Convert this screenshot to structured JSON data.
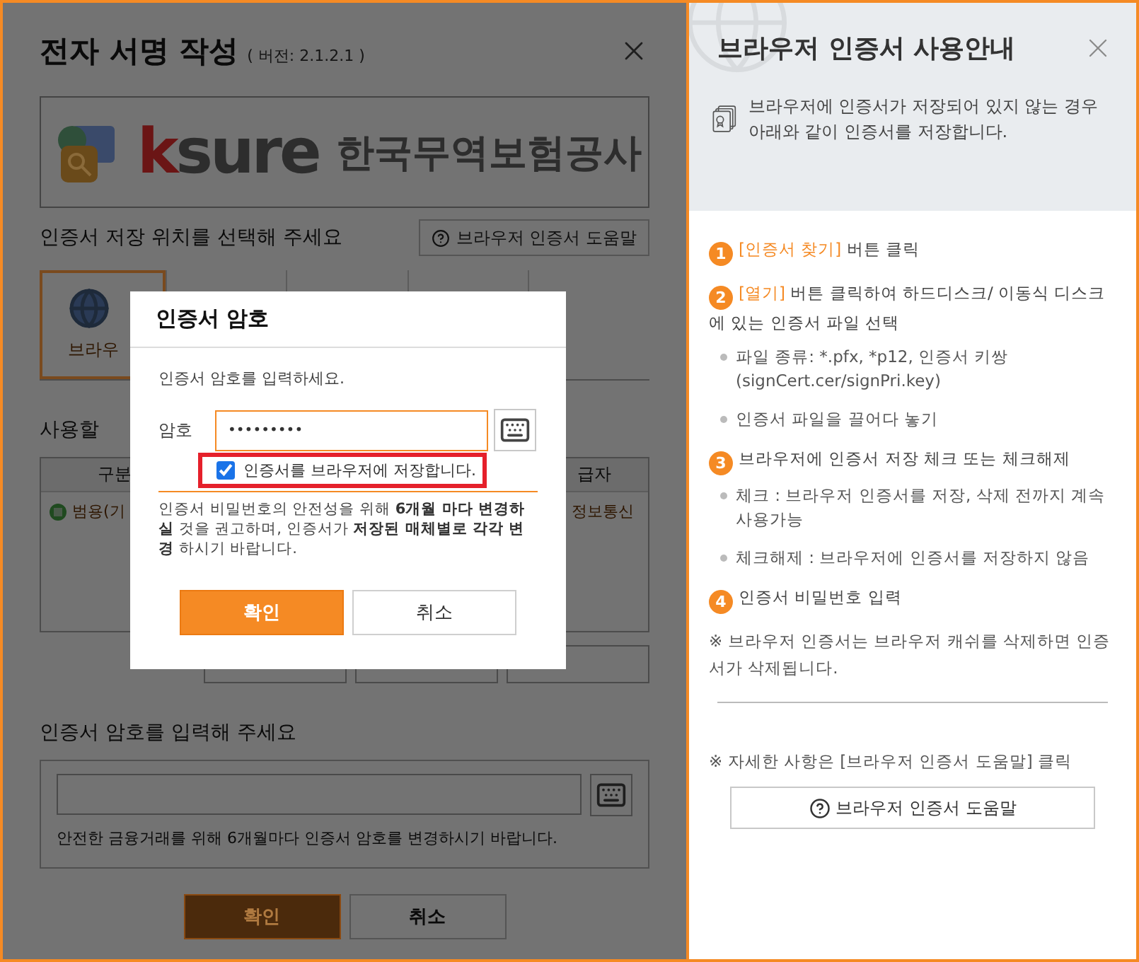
{
  "main_dialog": {
    "title": "전자 서명 작성",
    "version": "( 버전: 2.1.2.1 )",
    "logo": {
      "brand": "ksure",
      "company": "한국무역보험공사"
    },
    "location_prompt": "인증서 저장 위치를 선택해 주세요",
    "help_button": "브라우저 인증서 도움말",
    "storage_tabs": [
      {
        "label": "브라우",
        "selected": true
      },
      {
        "selected": false
      },
      {
        "selected": false
      },
      {
        "selected": false
      },
      {
        "selected": false
      }
    ],
    "cert_list_label": "사용할",
    "table": {
      "columns": [
        "구분",
        "급자"
      ],
      "rows": [
        {
          "cells": [
            "범용(기",
            "정보통신"
          ]
        }
      ]
    },
    "password_label": "인증서 암호를 입력해 주세요",
    "password_hint": "안전한 금융거래를 위해 6개월마다 인증서 암호를 변경하시기 바랍니다.",
    "buttons": [
      {
        "label": "확인",
        "kind": "primary"
      },
      {
        "label": "취소",
        "kind": "secondary"
      }
    ]
  },
  "password_modal": {
    "title": "인증서 암호",
    "prompt": "인증서 암호를 입력하세요.",
    "field_label": "암호",
    "value": "•••••••••",
    "save_checkbox": {
      "label": "인증서를 브라우저에 저장합니다.",
      "checked": true
    },
    "notice": "인증서 비밀번호의 안전성을 위해 **6개월 마다 변경하실** 것을 권고하며, 인증서가 **저장된 매체별로 각각 변경** 하시기 바랍니다.",
    "buttons": [
      {
        "label": "확인",
        "kind": "primary"
      },
      {
        "label": "취소",
        "kind": "secondary"
      }
    ]
  },
  "guide_panel": {
    "title": "브라우저 인증서 사용안내",
    "intro": "브라우저에 인증서가 저장되어 있지 않는 경우 아래와 같이 인증서를 저장합니다.",
    "steps": [
      {
        "number": "1",
        "highlight": "[인증서 찾기]",
        "text": "버튼 클릭"
      },
      {
        "number": "2",
        "highlight": "[열기]",
        "text": "버튼 클릭하여 하드디스크/ 이동식 디스크에 있는 인증서 파일 선택",
        "bullets": [
          "파일 종류: *.pfx, *p12, 인증서 키쌍 (signCert.cer/signPri.key)",
          "인증서 파일을 끌어다 놓기"
        ]
      },
      {
        "number": "3",
        "text": "브라우저에 인증서 저장 체크 또는 체크해제",
        "bullets": [
          "체크 : 브라우저 인증서를 저장, 삭제 전까지 계속 사용가능",
          "체크해제 : 브라우저에 인증서를 저장하지 않음"
        ]
      },
      {
        "number": "4",
        "text": "인증서 비밀번호 입력"
      }
    ],
    "cache_note": "※ 브라우저 인증서는 브라우저 캐쉬를 삭제하면 인증서가 삭제됩니다.",
    "detail_note": "※ 자세한 사항은 [브라우저 인증서 도움말] 클릭",
    "help_button": "브라우저 인증서 도움말"
  }
}
